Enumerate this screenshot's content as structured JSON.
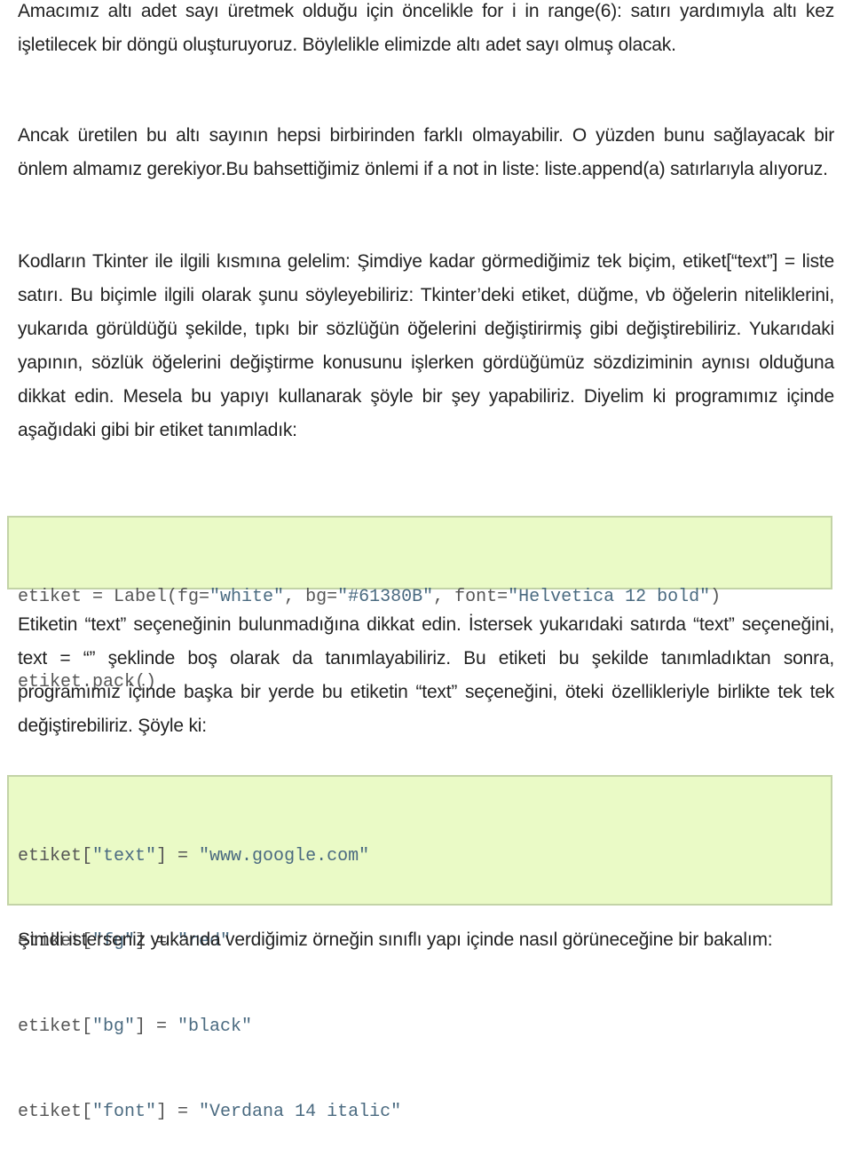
{
  "paragraphs": [
    "Amacımız altı adet sayı üretmek olduğu için öncelikle for i in range(6): satırı yardımıyla altı kez işletilecek bir döngü oluşturuyoruz. Böylelikle elimizde altı adet sayı olmuş olacak.",
    "Ancak üretilen bu altı sayının hepsi birbirinden farklı olmayabilir. O yüzden bunu sağlayacak bir önlem almamız gerekiyor.Bu bahsettiğimiz önlemi if a not in liste: liste.append(a) satırlarıyla alıyoruz.",
    "Kodların Tkinter ile ilgili kısmına gelelim: Şimdiye kadar görmediğimiz tek biçim, etiket[“text”] = liste satırı. Bu biçimle ilgili olarak şunu söyleyebiliriz: Tkinter’deki etiket, düğme, vb öğelerin niteliklerini, yukarıda görüldüğü şekilde, tıpkı bir sözlüğün öğelerini değiştirirmiş gibi değiştirebiliriz. Yukarıdaki yapının, sözlük öğelerini değiştirme konusunu işlerken gördüğümüz sözdiziminin aynısı olduğuna dikkat edin. Mesela bu yapıyı kullanarak şöyle bir şey yapabiliriz. Diyelim ki programımız içinde aşağıdaki gibi bir etiket tanımladık:",
    "Etiketin “text” seçeneğinin bulunmadığına dikkat edin. İstersek yukarıdaki satırda “text” seçeneğini, text = “” şeklinde boş olarak da tanımlayabiliriz. Bu etiketi bu şekilde tanımladıktan sonra, programımız içinde başka bir yerde bu etiketin “text” seçeneğini, öteki özellikleriyle birlikte tek tek değiştirebiliriz. Şöyle ki:",
    "Şimdi isterseniz yukarıda verdiğimiz örneğin sınıflı yapı içinde nasıl görüneceğine bir bakalım:"
  ],
  "code_blocks": [
    {
      "lines": [
        "etiket = Label(fg=\"white\", bg=\"#61380B\", font=\"Helvetica 12 bold\")",
        "etiket.pack()"
      ]
    },
    {
      "lines": [
        "etiket[\"text\"] = \"www.google.com\"",
        "etiket[\"fg\"] = \"red\"",
        "etiket[\"bg\"] = \"black\"",
        "etiket[\"font\"] = \"Verdana 14 italic\""
      ]
    }
  ],
  "colors": {
    "code_background": "#eafac6",
    "code_border": "#c3d3a7",
    "body_text": "#222222",
    "code_text": "#555555",
    "code_string": "#4a6a80"
  }
}
